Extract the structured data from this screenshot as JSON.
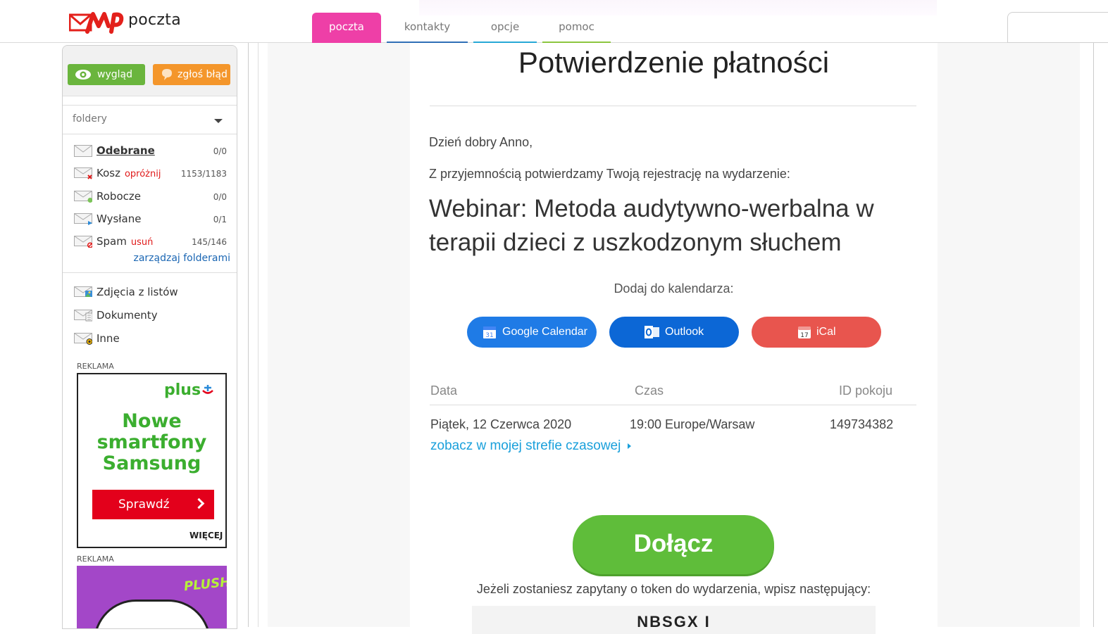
{
  "app": {
    "logo_text": "poczta"
  },
  "tabs": [
    {
      "label": "poczta",
      "active": true,
      "underline": ""
    },
    {
      "label": "kontakty",
      "active": false,
      "underline": "#2f6fb6"
    },
    {
      "label": "opcje",
      "active": false,
      "underline": "#27a8d6"
    },
    {
      "label": "pomoc",
      "active": false,
      "underline": "#8cc63f"
    }
  ],
  "sidebar": {
    "buttons": {
      "appearance": "wygląd",
      "report": "zgłoś błąd"
    },
    "folders_header": "foldery",
    "folders": [
      {
        "name": "Odebrane",
        "action": "",
        "count": "0/0",
        "bold": true,
        "badge": ""
      },
      {
        "name": "Kosz",
        "action": "opróżnij",
        "count": "1153/1183",
        "bold": false,
        "badge": "x"
      },
      {
        "name": "Robocze",
        "action": "",
        "count": "0/0",
        "bold": false,
        "badge": "green"
      },
      {
        "name": "Wysłane",
        "action": "",
        "count": "0/1",
        "bold": false,
        "badge": "blue"
      },
      {
        "name": "Spam",
        "action": "usuń",
        "count": "145/146",
        "bold": false,
        "badge": "red"
      }
    ],
    "manage_folders": "zarządzaj folderami",
    "smart_folders": [
      {
        "name": "Zdjęcia z listów",
        "badge": "photo"
      },
      {
        "name": "Dokumenty",
        "badge": "doc"
      },
      {
        "name": "Inne",
        "badge": "other"
      }
    ],
    "ad1": {
      "label": "REKLAMA",
      "brand": "plus",
      "headline_1": "Nowe",
      "headline_2": "smartfony",
      "headline_3": "Samsung",
      "cta": "Sprawdź",
      "more": "WIĘCEJ"
    },
    "ad2": {
      "label": "REKLAMA",
      "brand": "PLUSH"
    }
  },
  "message": {
    "title": "Potwierdzenie płatności",
    "greeting": "Dzień dobry Anno,",
    "intro": "Z przyjemnością potwierdzamy Twoją rejestrację na wydarzenie:",
    "event_line_1": "Webinar: Metoda audytywno-werbalna w",
    "event_line_2": "terapii dzieci z uszkodzonym słuchem",
    "calendar_label": "Dodaj do kalendarza:",
    "calendar_buttons": {
      "google": "Google Calendar",
      "outlook": "Outlook",
      "ical": "iCal"
    },
    "colors": {
      "google": "#1f7be6",
      "outlook": "#0c67d6",
      "ical": "#e8554e",
      "join": "#5fbd3a"
    },
    "table": {
      "headers": {
        "date": "Data",
        "time": "Czas",
        "room": "ID pokoju"
      },
      "row": {
        "date": "Piątek, 12 Czerwca 2020",
        "time": "19:00 Europe/Warsaw",
        "room": "149734382"
      }
    },
    "timezone_link": "zobacz w mojej strefie czasowej",
    "join_button": "Dołącz",
    "token_text": "Jeżeli zostaniesz zapytany o token do wydarzenia, wpisz następujący:",
    "token_value": "NBSGX I"
  }
}
